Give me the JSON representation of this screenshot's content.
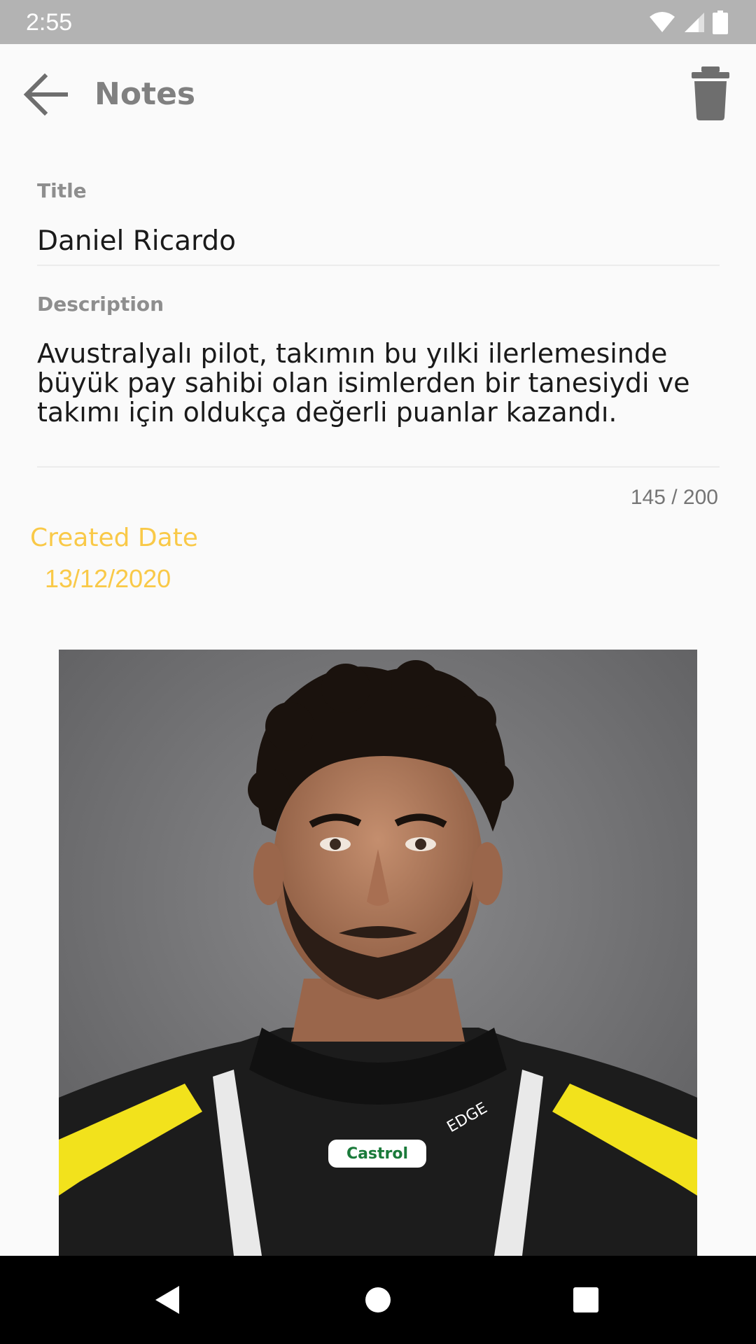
{
  "status_bar": {
    "time": "2:55",
    "icons": [
      "wifi-icon",
      "cell-signal-icon",
      "battery-icon"
    ]
  },
  "app_bar": {
    "title": "Notes",
    "back_icon": "arrow-back-icon",
    "delete_icon": "trash-icon"
  },
  "form": {
    "title_label": "Title",
    "title_value": "Daniel Ricardo",
    "description_label": "Description",
    "description_value": "Avustralyalı pilot, takımın bu yılki ilerlemesinde büyük pay sahibi olan isimlerden bir tanesiydi ve takımı için oldukça değerli puanlar kazandı.",
    "char_counter": "145 / 200",
    "created_label": "Created Date",
    "created_value": "13/12/2020"
  },
  "photo": {
    "logo_text": "Castrol",
    "collar_text": "EDGE"
  },
  "navigation_bar": {
    "buttons": [
      "back-triangle-icon",
      "home-circle-icon",
      "recents-square-icon"
    ]
  },
  "colors": {
    "accent": "#f9c948",
    "status_bar": "#b3b3b3",
    "background": "#fafafa"
  }
}
